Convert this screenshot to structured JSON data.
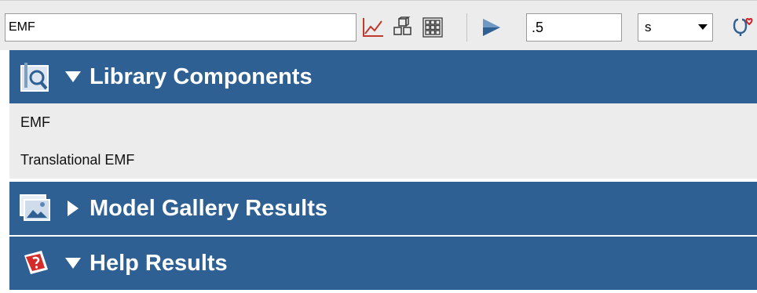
{
  "toolbar": {
    "search_value": "EMF",
    "stop_time_value": ".5",
    "stop_time_unit": "s",
    "icons": [
      "chart-icon",
      "blocks-icon",
      "library-grid-icon",
      "play-icon",
      "stethoscope-icon"
    ],
    "accent_color": "#2f6094"
  },
  "sections": {
    "library": {
      "title": "Library Components",
      "expanded": true,
      "items": [
        "EMF",
        "Translational EMF"
      ]
    },
    "gallery": {
      "title": "Model Gallery Results",
      "expanded": false
    },
    "help": {
      "title": "Help Results",
      "expanded": true
    }
  }
}
